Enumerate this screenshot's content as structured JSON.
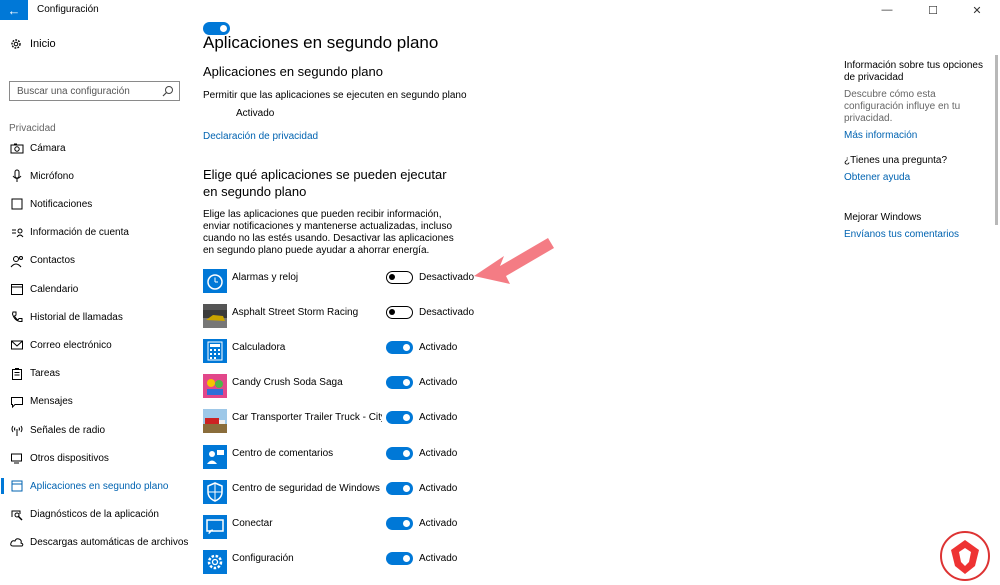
{
  "window": {
    "title": "Configuración",
    "back_glyph": "←",
    "minimize_glyph": "—",
    "maximize_glyph": "☐",
    "close_glyph": "✕"
  },
  "sidebar": {
    "home_label": "Inicio",
    "search_placeholder": "Buscar una configuración",
    "section_label": "Privacidad",
    "items": [
      {
        "label": "Cámara",
        "icon": "camera-icon"
      },
      {
        "label": "Micrófono",
        "icon": "microphone-icon"
      },
      {
        "label": "Notificaciones",
        "icon": "notifications-icon"
      },
      {
        "label": "Información de cuenta",
        "icon": "account-info-icon"
      },
      {
        "label": "Contactos",
        "icon": "contacts-icon"
      },
      {
        "label": "Calendario",
        "icon": "calendar-icon"
      },
      {
        "label": "Historial de llamadas",
        "icon": "call-history-icon"
      },
      {
        "label": "Correo electrónico",
        "icon": "email-icon"
      },
      {
        "label": "Tareas",
        "icon": "tasks-icon"
      },
      {
        "label": "Mensajes",
        "icon": "messages-icon"
      },
      {
        "label": "Señales de radio",
        "icon": "radio-icon"
      },
      {
        "label": "Otros dispositivos",
        "icon": "devices-icon"
      },
      {
        "label": "Aplicaciones en segundo plano",
        "icon": "background-apps-icon",
        "active": true
      },
      {
        "label": "Diagnósticos de la aplicación",
        "icon": "diagnostics-icon"
      },
      {
        "label": "Descargas automáticas de archivos",
        "icon": "downloads-icon"
      }
    ]
  },
  "main": {
    "page_title": "Aplicaciones en segundo plano",
    "section1_title": "Aplicaciones en segundo plano",
    "allow_text": "Permitir que las aplicaciones se ejecuten en segundo plano",
    "master_state": "Activado",
    "privacy_link": "Declaración de privacidad",
    "section2_title": "Elige qué aplicaciones se pueden ejecutar en segundo plano",
    "description": "Elige las aplicaciones que pueden recibir información, enviar notificaciones y mantenerse actualizadas, incluso cuando no las estés usando. Desactivar las aplicaciones en segundo plano puede ayudar a ahorrar energía.",
    "apps": [
      {
        "name": "Alarmas y reloj",
        "state": "Desactivado",
        "on": false,
        "icon": "alarm-clock-icon"
      },
      {
        "name": "Asphalt Street Storm Racing",
        "state": "Desactivado",
        "on": false,
        "icon": "asphalt-racing-icon"
      },
      {
        "name": "Calculadora",
        "state": "Activado",
        "on": true,
        "icon": "calculator-icon"
      },
      {
        "name": "Candy Crush Soda Saga",
        "state": "Activado",
        "on": true,
        "icon": "candy-crush-icon"
      },
      {
        "name": "Car Transporter Trailer Truck - City C...",
        "state": "Activado",
        "on": true,
        "icon": "car-transporter-icon"
      },
      {
        "name": "Centro de comentarios",
        "state": "Activado",
        "on": true,
        "icon": "feedback-hub-icon"
      },
      {
        "name": "Centro de seguridad de Windows D...",
        "state": "Activado",
        "on": true,
        "icon": "security-center-icon"
      },
      {
        "name": "Conectar",
        "state": "Activado",
        "on": true,
        "icon": "connect-icon"
      },
      {
        "name": "Configuración",
        "state": "Activado",
        "on": true,
        "icon": "settings-gear-icon"
      }
    ]
  },
  "right_panel": {
    "info_title": "Información sobre tus opciones de privacidad",
    "info_desc": "Descubre cómo esta configuración influye en tu privacidad.",
    "info_link": "Más información",
    "question_title": "¿Tienes una pregunta?",
    "question_link": "Obtener ayuda",
    "improve_title": "Mejorar Windows",
    "improve_link": "Envíanos tus comentarios"
  },
  "colors": {
    "accent": "#0078d7",
    "link": "#0063b1",
    "arrow": "#f47c84"
  }
}
